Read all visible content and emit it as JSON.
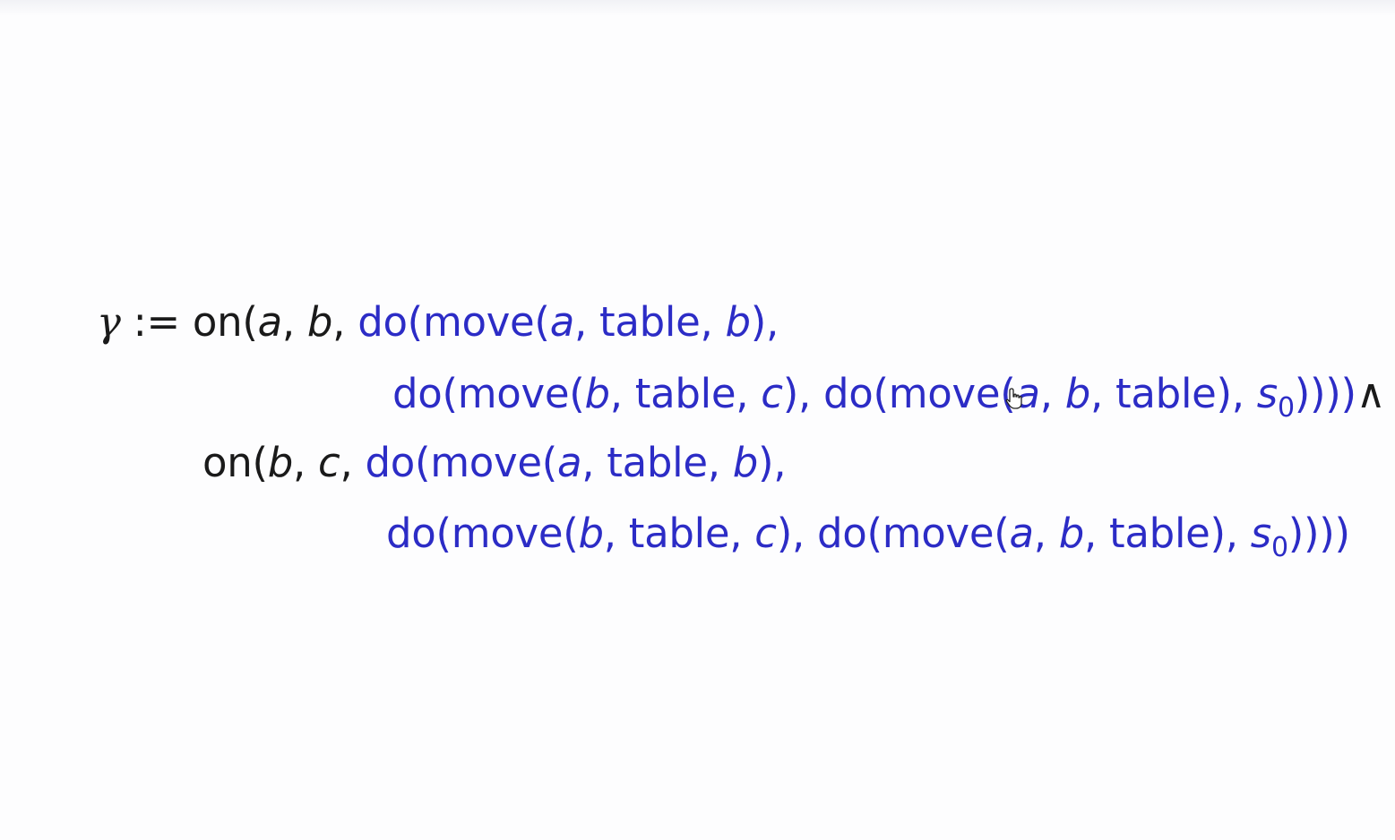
{
  "formula": {
    "line1": {
      "gamma": "γ",
      "assign": " := ",
      "black_prefix": "on(",
      "a": "a",
      "sep1": ", ",
      "b": "b",
      "sep2": ", ",
      "blue_part1": "do(move(",
      "a2": "a",
      "blue_part2": ", table, ",
      "b2": "b",
      "blue_part3": "),"
    },
    "line2": {
      "part1": "do(move(",
      "b": "b",
      "part2": ", table, ",
      "c": "c",
      "part3": "), do(move(",
      "a": "a",
      "part4": ", ",
      "b2": "b",
      "part5": ", table), ",
      "s": "s",
      "s_sub": "0",
      "part6": "))))",
      "conj": "∧"
    },
    "line3": {
      "black_prefix": "on(",
      "b": "b",
      "sep1": ", ",
      "c": "c",
      "sep2": ", ",
      "blue_part1": "do(move(",
      "a": "a",
      "blue_part2": ", table, ",
      "b2": "b",
      "blue_part3": "),"
    },
    "line4": {
      "part1": "do(move(",
      "b": "b",
      "part2": ", table, ",
      "c": "c",
      "part3": "), do(move(",
      "a": "a",
      "part4": ", ",
      "b2": "b",
      "part5": ", table), ",
      "s": "s",
      "s_sub": "0",
      "part6": "))))"
    }
  },
  "colors": {
    "text": "#1a1a1a",
    "highlight": "#2c2cc6",
    "background": "#fdfdfe"
  },
  "icons": {
    "cursor": "hand-pointer-icon"
  }
}
